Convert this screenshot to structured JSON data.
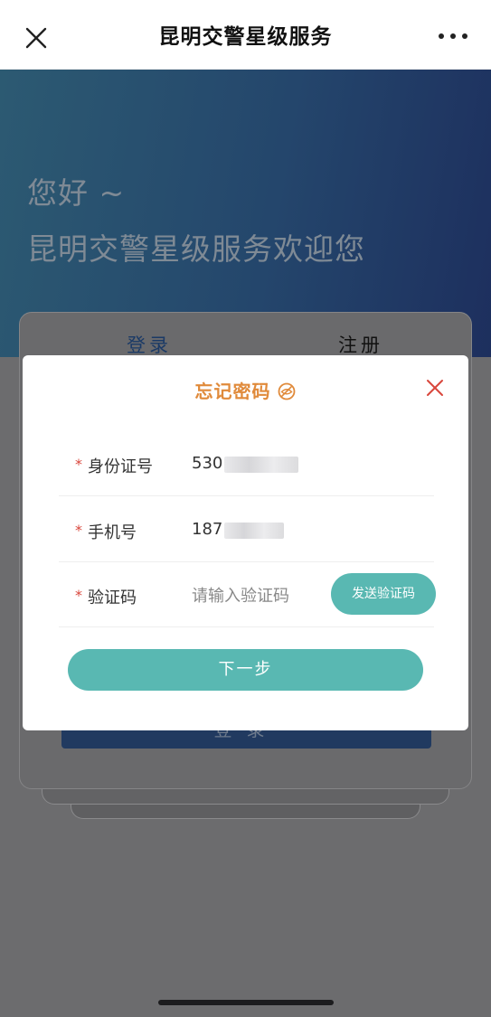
{
  "navbar": {
    "title": "昆明交警星级服务",
    "close_icon": "close-icon",
    "more_icon": "more-icon"
  },
  "banner": {
    "greeting_line1": "您好 ~",
    "greeting_line2": "昆明交警星级服务欢迎您"
  },
  "background_card": {
    "tab_login": "登录",
    "tab_register": "注册",
    "login_button": "登录"
  },
  "modal": {
    "title": "忘记密码",
    "title_icon": "eye-slash-icon",
    "close_icon": "close-icon",
    "required_mark": "*",
    "fields": [
      {
        "label": "身份证号",
        "value_prefix": "530"
      },
      {
        "label": "手机号",
        "value_prefix": "187"
      },
      {
        "label": "验证码",
        "placeholder": "请输入验证码"
      }
    ],
    "send_code_button": "发送验证码",
    "next_button": "下一步"
  },
  "colors": {
    "accent_teal": "#59b8b2",
    "title_orange": "#e08a3a",
    "required_red": "#d9473d",
    "banner_blue": "#24466c"
  }
}
